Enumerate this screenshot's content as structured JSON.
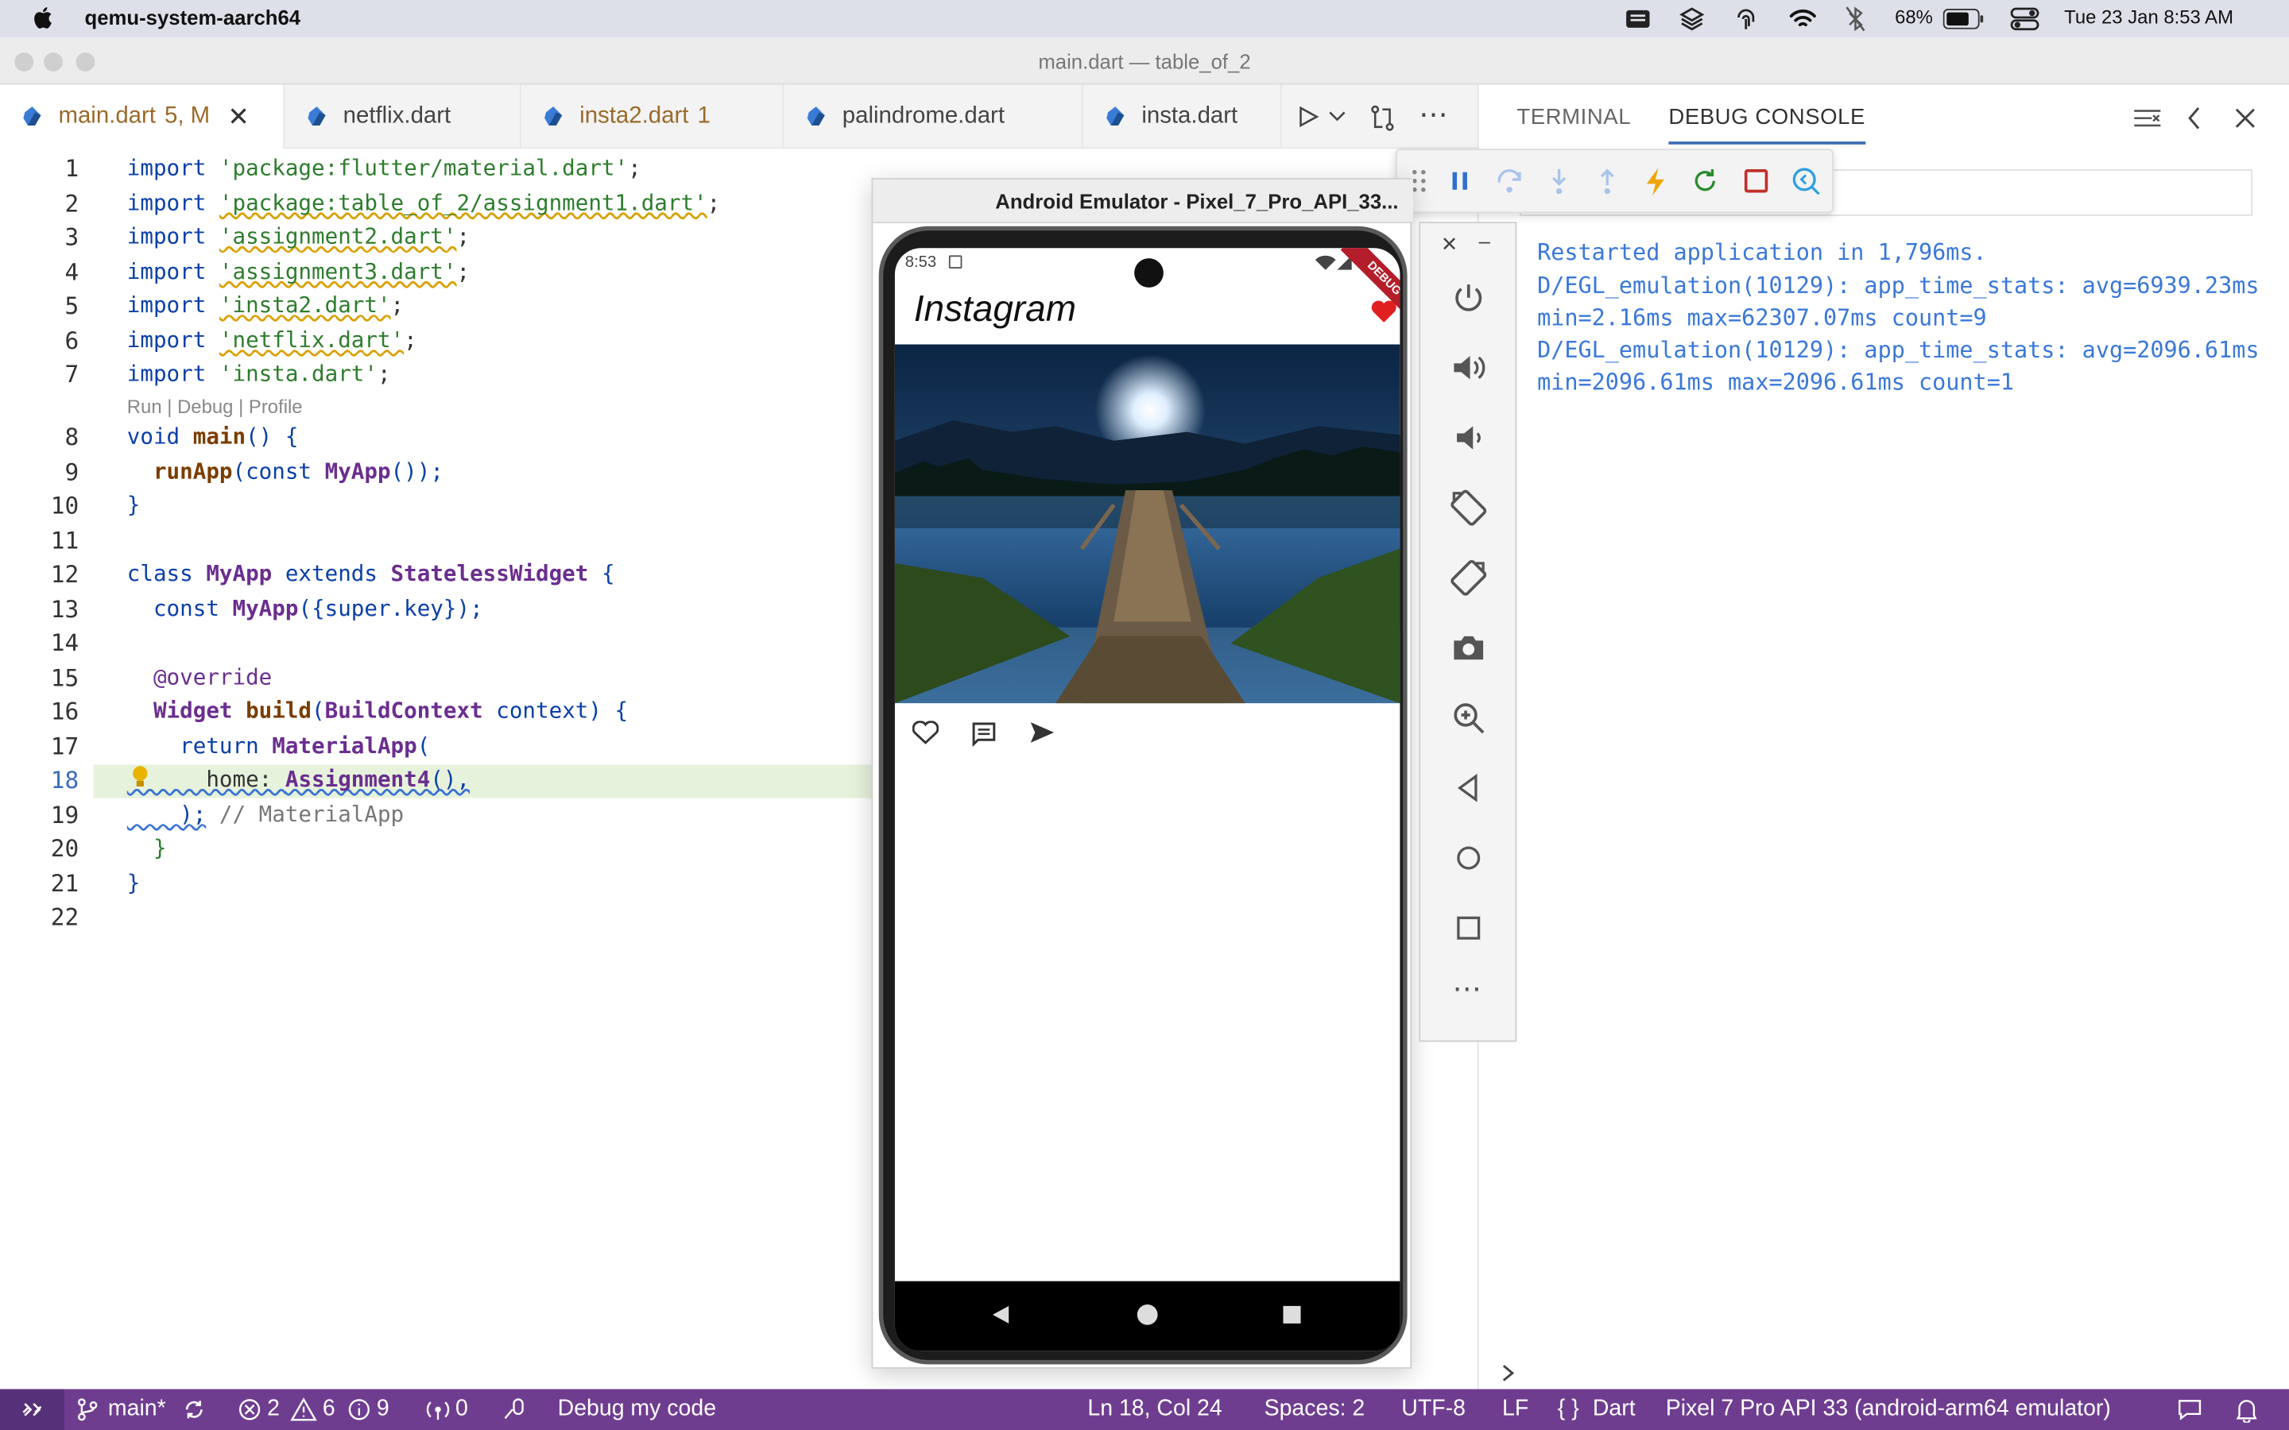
{
  "menubar": {
    "app_name": "qemu-system-aarch64",
    "battery": "68%",
    "datetime": "Tue 23 Jan  8:53 AM"
  },
  "window": {
    "title": "main.dart — table_of_2"
  },
  "tabs": [
    {
      "label": "main.dart",
      "badge": "5, M"
    },
    {
      "label": "netflix.dart"
    },
    {
      "label": "insta2.dart",
      "badge": "1"
    },
    {
      "label": "palindrome.dart"
    },
    {
      "label": "insta.dart"
    }
  ],
  "editor": {
    "codelens": "Run | Debug | Profile",
    "lines": [
      {
        "n": "1"
      },
      {
        "n": "2"
      },
      {
        "n": "3"
      },
      {
        "n": "4"
      },
      {
        "n": "5"
      },
      {
        "n": "6"
      },
      {
        "n": "7"
      },
      {
        "n": "8"
      },
      {
        "n": "9"
      },
      {
        "n": "10"
      },
      {
        "n": "11"
      },
      {
        "n": "12"
      },
      {
        "n": "13"
      },
      {
        "n": "14"
      },
      {
        "n": "15"
      },
      {
        "n": "16"
      },
      {
        "n": "17"
      },
      {
        "n": "18"
      },
      {
        "n": "19"
      },
      {
        "n": "20"
      },
      {
        "n": "21"
      },
      {
        "n": "22"
      }
    ],
    "code": {
      "l1a": "import ",
      "l1b": "'package:flutter/material.dart'",
      "l1c": ";",
      "l2a": "import ",
      "l2b": "'package:table_of_2/assignment1.dart'",
      "l2c": ";",
      "l3a": "import ",
      "l3b": "'assignment2.dart'",
      "l3c": ";",
      "l4a": "import ",
      "l4b": "'assignment3.dart'",
      "l4c": ";",
      "l5a": "import ",
      "l5b": "'insta2.dart'",
      "l5c": ";",
      "l6a": "import ",
      "l6b": "'netflix.dart'",
      "l6c": ";",
      "l7a": "import ",
      "l7b": "'insta.dart'",
      "l7c": ";",
      "l8a": "void ",
      "l8b": "main",
      "l8c": "() {",
      "l9a": "  ",
      "l9b": "runApp",
      "l9c": "(const ",
      "l9d": "MyApp",
      "l9e": "());",
      "l10": "}",
      "l12a": "class ",
      "l12b": "MyApp",
      "l12c": " extends ",
      "l12d": "StatelessWidget",
      "l12e": " {",
      "l13a": "  const ",
      "l13b": "MyApp",
      "l13c": "({super.key});",
      "l15": "  @override",
      "l16a": "  ",
      "l16b": "Widget",
      "l16c": " build",
      "l16d": "(",
      "l16e": "BuildContext",
      "l16f": " context) {",
      "l17a": "    return ",
      "l17b": "MaterialApp",
      "l17c": "(",
      "l18a": "      home: ",
      "l18b": "Assignment4",
      "l18c": "(),",
      "l19a": "    );",
      "l19b": " // MaterialApp",
      "l20": "  }",
      "l21": "}"
    }
  },
  "panel": {
    "tabs": [
      "TERMINAL",
      "DEBUG CONSOLE"
    ],
    "console": [
      "Restarted application in 1,796ms.",
      "D/EGL_emulation(10129): app_time_stats: avg=6939.23ms",
      "min=2.16ms max=62307.07ms count=9",
      "D/EGL_emulation(10129): app_time_stats: avg=2096.61ms",
      "min=2096.61ms max=2096.61ms count=1"
    ]
  },
  "emulator": {
    "title": "Android Emulator - Pixel_7_Pro_API_33...",
    "phone_time": "8:53",
    "app_title": "Instagram",
    "debug_banner": "DEBUG"
  },
  "statusbar": {
    "branch": "main*",
    "errors": "2",
    "warnings": "6",
    "infos": "9",
    "ports": "0",
    "debug": "Debug my code",
    "position": "Ln 18, Col 24",
    "spaces": "Spaces: 2",
    "encoding": "UTF-8",
    "eol": "LF",
    "language": "Dart",
    "device": "Pixel 7 Pro API 33 (android-arm64 emulator)"
  },
  "colors": {
    "status_bar": "#6f3d90",
    "console_text": "#3a78d8",
    "tab_active_text": "#9a6a2a"
  }
}
